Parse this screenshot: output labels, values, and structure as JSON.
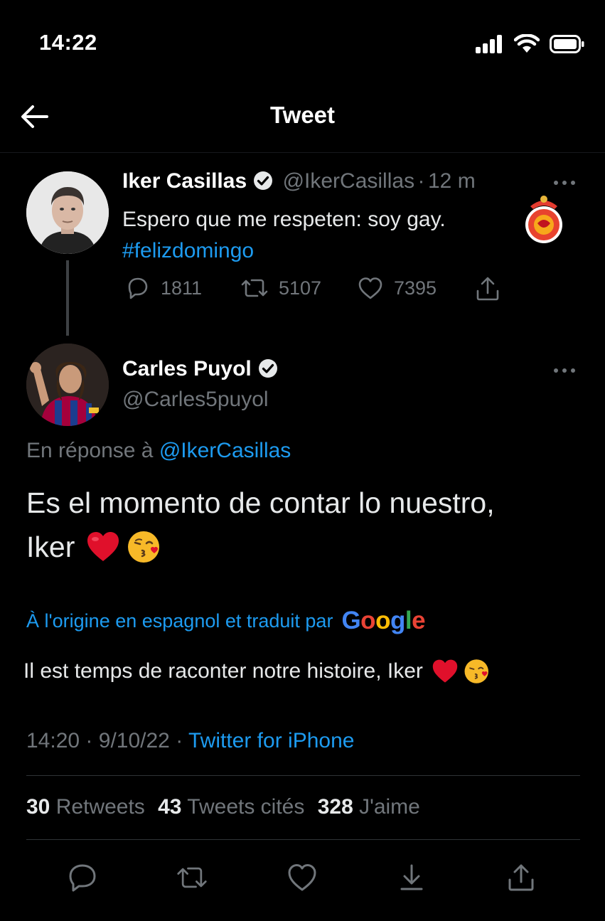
{
  "status_bar": {
    "time": "14:22"
  },
  "header": {
    "title": "Tweet"
  },
  "tweet1": {
    "name": "Iker Casillas",
    "handle": "@IkerCasillas",
    "separator": "·",
    "time": "12 m",
    "text": "Espero que me respeten: soy gay.",
    "hashtag": "#felizdomingo",
    "replies": "1811",
    "retweets": "5107",
    "likes": "7395"
  },
  "tweet2": {
    "name": "Carles Puyol",
    "handle": "@Carles5puyol",
    "reply_prefix": "En réponse à",
    "reply_handle": "@IkerCasillas",
    "text_line1": "Es el momento de contar lo nuestro,",
    "text_line2": "Iker",
    "translated_by": "À l'origine en espagnol et traduit par",
    "google": "Google",
    "translation": "Il est temps de raconter notre histoire, Iker",
    "time": "14:20",
    "date": "9/10/22",
    "dot": "·",
    "client": "Twitter for iPhone",
    "retweets_count": "30",
    "retweets_label": "Retweets",
    "quotes_count": "43",
    "quotes_label": "Tweets cités",
    "likes_count": "328",
    "likes_label": "J'aime"
  },
  "colors": {
    "background": "#000000",
    "link": "#1d9bf0",
    "muted": "#71767b",
    "heart": "#e0102b"
  },
  "icons": [
    "back-arrow-icon",
    "verified-icon",
    "more-icon",
    "reply-icon",
    "retweet-icon",
    "like-icon",
    "share-icon",
    "bookmark-icon"
  ]
}
